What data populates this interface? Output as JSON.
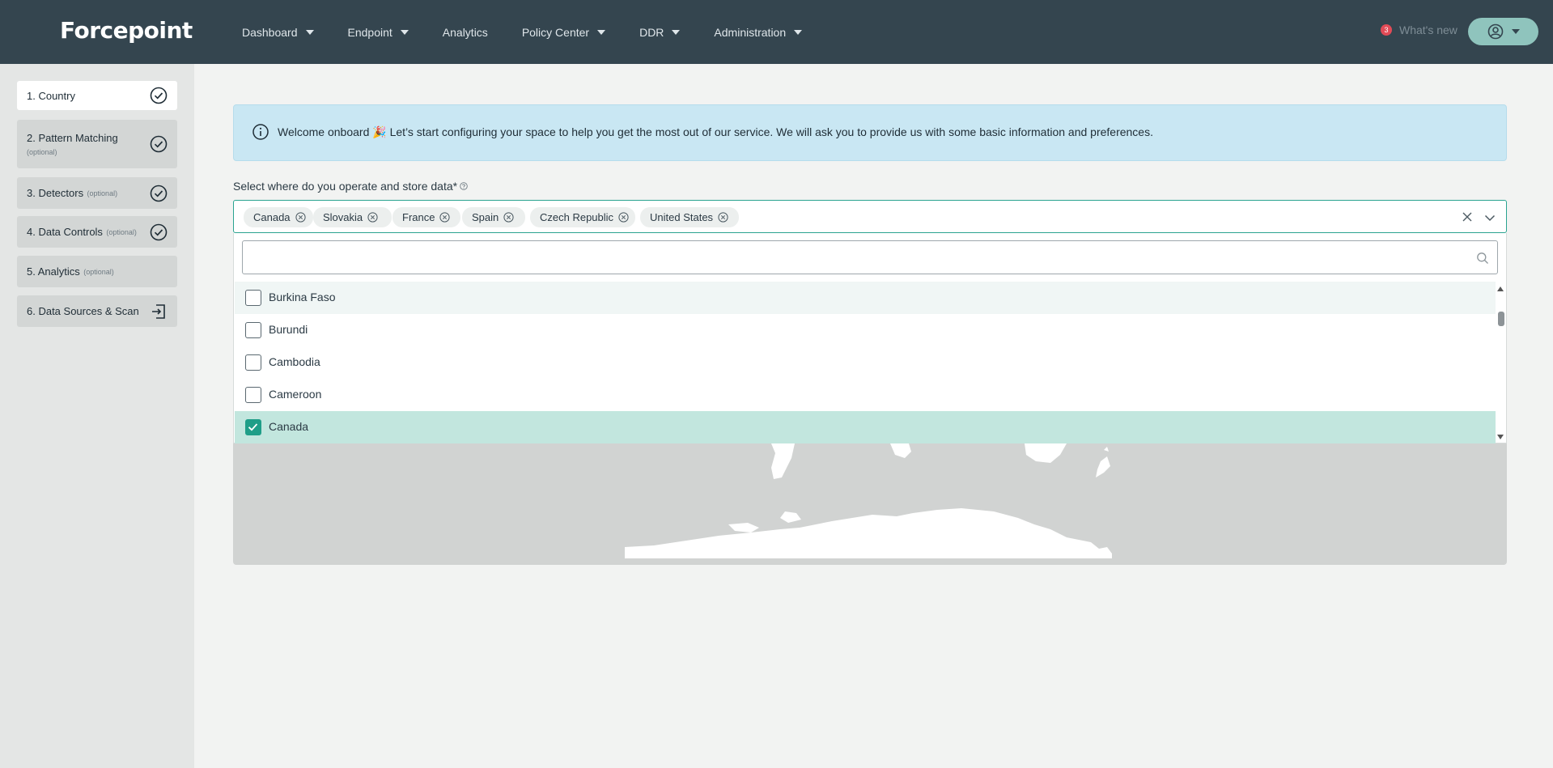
{
  "header": {
    "logo": "Forcepoint",
    "nav": [
      {
        "label": "Dashboard",
        "caret": true
      },
      {
        "label": "Endpoint",
        "caret": true
      },
      {
        "label": "Analytics",
        "caret": false
      },
      {
        "label": "Policy Center",
        "caret": true
      },
      {
        "label": "DDR",
        "caret": true
      },
      {
        "label": "Administration",
        "caret": true
      }
    ],
    "whats_new_count": "3",
    "whats_new_label": "What's new",
    "user_icon": "user-circle-icon"
  },
  "sidebar": {
    "steps": [
      {
        "label": "1. Country",
        "optional": "",
        "icon": "check-circle-icon"
      },
      {
        "label": "2. Pattern Matching",
        "optional": "(optional)",
        "icon": "check-circle-icon"
      },
      {
        "label": "3. Detectors",
        "optional": "(optional)",
        "icon": "check-circle-icon"
      },
      {
        "label": "4. Data Controls",
        "optional": "(optional)",
        "icon": "check-circle-icon"
      },
      {
        "label": "5. Analytics",
        "optional": "(optional)",
        "icon": ""
      },
      {
        "label": "6. Data Sources & Scan",
        "optional": "",
        "icon": "exit-icon"
      }
    ]
  },
  "main": {
    "info_text": "Welcome onboard 🎉 Let’s start configuring your space to help you get the most out of our service. We will ask you to provide us with some basic information and preferences.",
    "field_label": "Select where do you operate and store data*",
    "selected_chips": [
      "Canada",
      "Slovakia",
      "France",
      "Spain",
      "Czech Republic",
      "United States"
    ],
    "search_placeholder": "",
    "options": [
      {
        "label": "Burkina Faso",
        "checked": false
      },
      {
        "label": "Burundi",
        "checked": false
      },
      {
        "label": "Cambodia",
        "checked": false
      },
      {
        "label": "Cameroon",
        "checked": false
      },
      {
        "label": "Canada",
        "checked": true
      }
    ]
  },
  "colors": {
    "topbar": "#34454f",
    "accent": "#1f9e88",
    "info_bg": "#c9e7f3",
    "badge": "#e24b57"
  }
}
